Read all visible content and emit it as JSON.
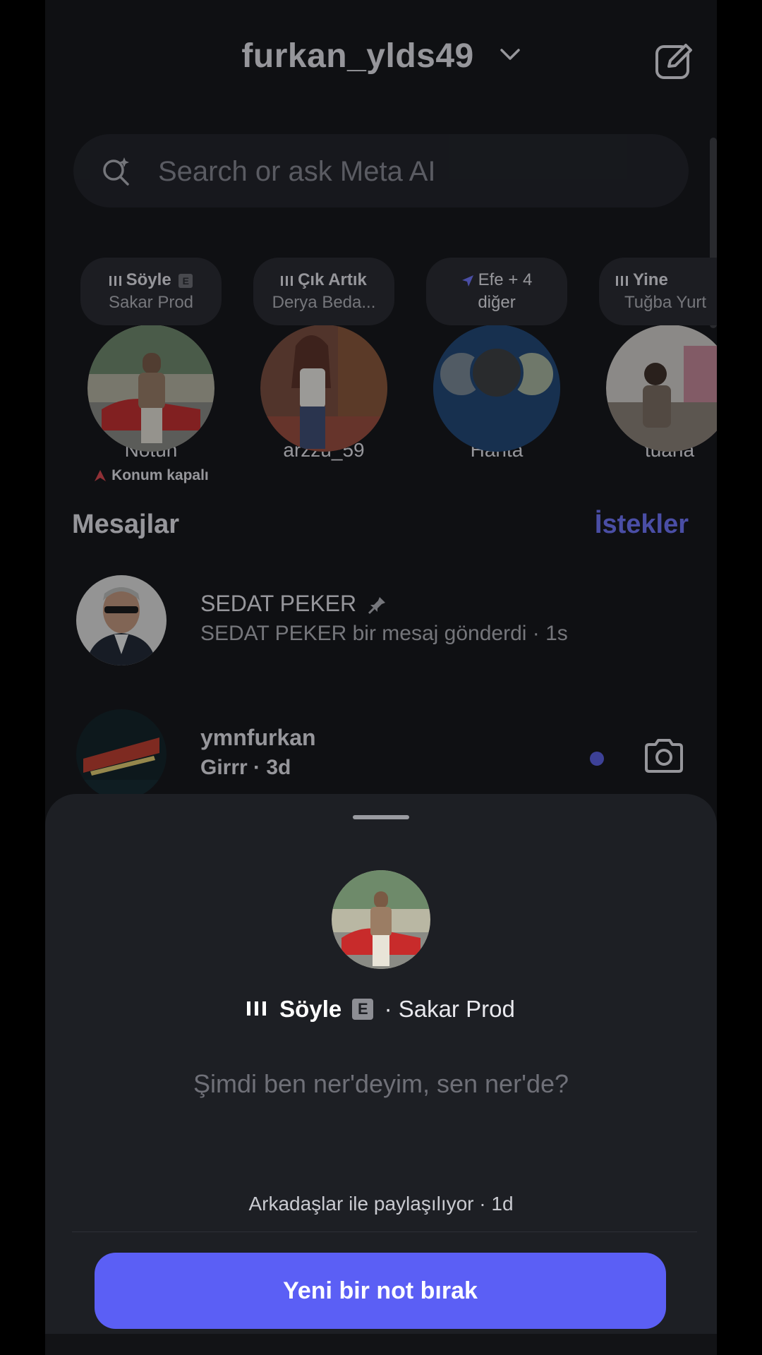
{
  "header": {
    "username": "furkan_ylds49"
  },
  "search": {
    "placeholder": "Search or ask Meta AI"
  },
  "notes": [
    {
      "song": "Söyle",
      "artist": "Sakar Prod",
      "name": "Notun",
      "status": "Konum kapalı"
    },
    {
      "song": "Çık Artık",
      "artist": "Derya Beda...",
      "name": "arzzu_59"
    },
    {
      "song": "Efe + 4",
      "artist": "diğer",
      "name": "Harita"
    },
    {
      "song": "Yine",
      "artist": "Tuğba Yurt",
      "name": "tuana"
    }
  ],
  "messages_section": {
    "title": "Mesajlar",
    "requests": "İstekler"
  },
  "messages": [
    {
      "name": "SEDAT PEKER",
      "preview": "SEDAT PEKER bir mesaj gönderdi · 1s"
    },
    {
      "name": "ymnfurkan",
      "preview": "Girrr · 3d"
    }
  ],
  "sheet": {
    "song": "Söyle",
    "explicit": "E",
    "artist": "· Sakar Prod",
    "note_text": "Şimdi ben ner'deyim, sen ner'de?",
    "shared": "Arkadaşlar ile paylaşılıyor · 1d",
    "button": "Yeni bir not bırak"
  },
  "colors": {
    "accent": "#5b5ff5",
    "link": "#6f74ff",
    "background": "#0f1013",
    "sheet": "#1d1f24"
  }
}
